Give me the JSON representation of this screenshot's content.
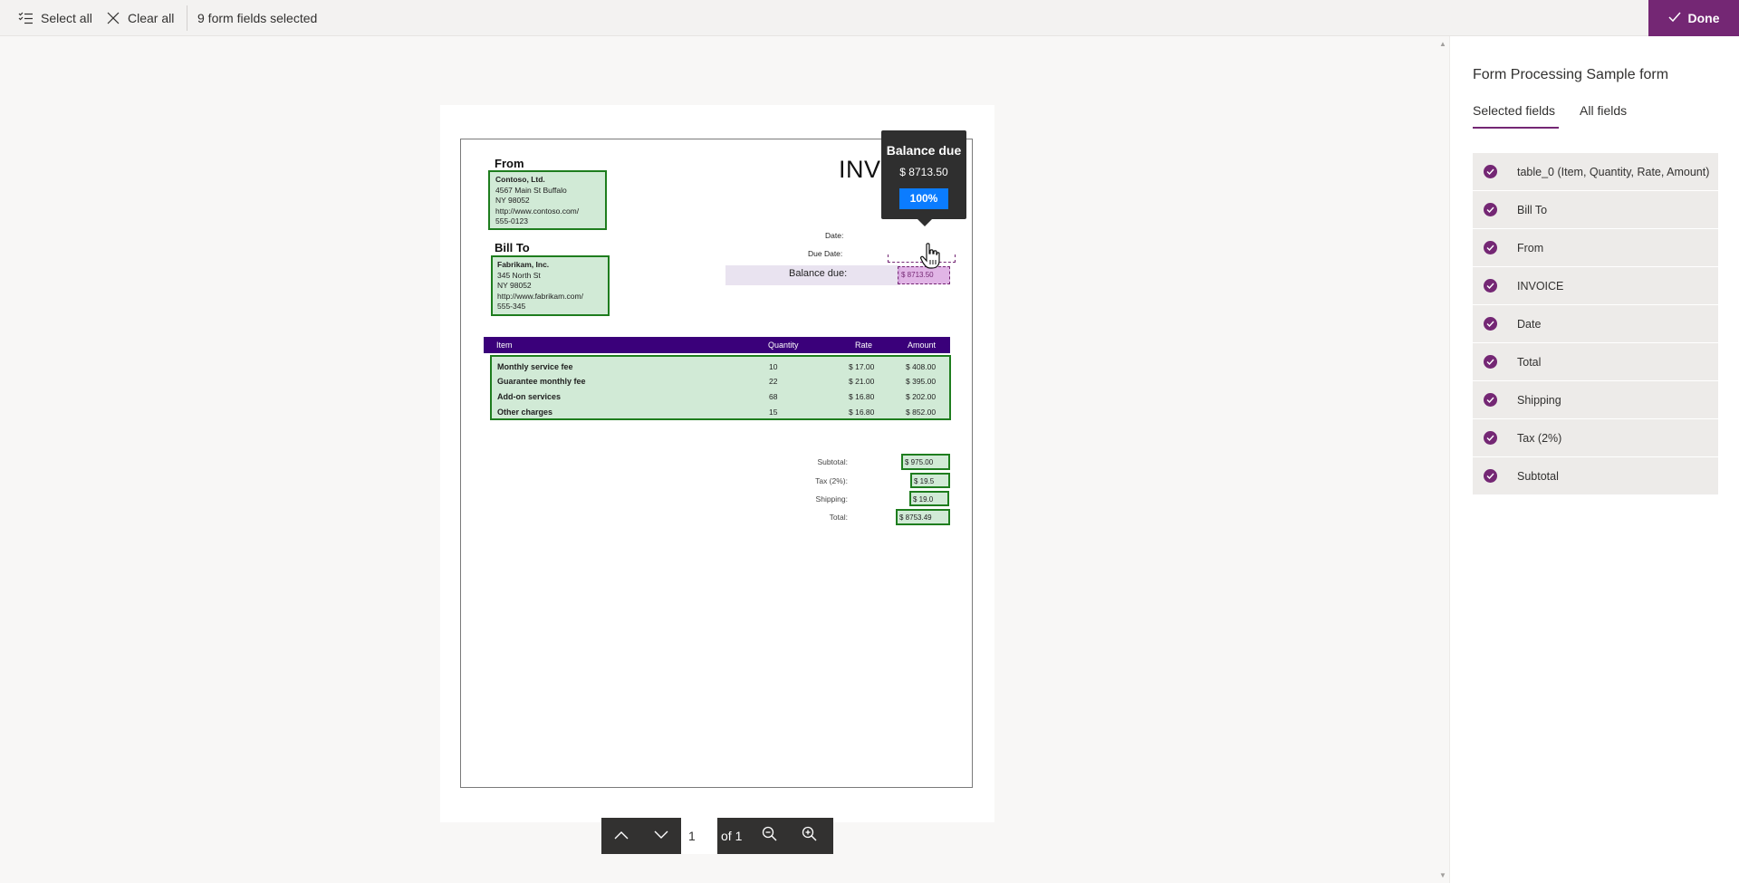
{
  "toolbar": {
    "select_all_label": "Select all",
    "clear_all_label": "Clear all",
    "selected_count_text": "9 form fields selected",
    "done_label": "Done",
    "accent_color": "#742774"
  },
  "document": {
    "from_heading": "From",
    "from_lines": [
      "Contoso, Ltd.",
      "4567 Main St Buffalo",
      "NY 98052",
      "http://www.contoso.com/",
      "555-0123"
    ],
    "bill_to_heading": "Bill To",
    "bill_to_lines": [
      "Fabrikam, Inc.",
      "345 North St",
      "NY 98052",
      "http://www.fabrikam.com/",
      "555-345"
    ],
    "invoice_title": "INVOICE",
    "date_label": "Date:",
    "due_date_label": "Due Date:",
    "balance_due_label": "Balance due:",
    "balance_due_value": "$ 8713.50",
    "table_headers": [
      "Item",
      "Quantity",
      "Rate",
      "Amount"
    ],
    "table_rows": [
      {
        "item": "Monthly service fee",
        "quantity": "10",
        "rate": "$ 17.00",
        "amount": "$ 408.00"
      },
      {
        "item": "Guarantee monthly fee",
        "quantity": "22",
        "rate": "$ 21.00",
        "amount": "$ 395.00"
      },
      {
        "item": "Add-on services",
        "quantity": "68",
        "rate": "$ 16.80",
        "amount": "$ 202.00"
      },
      {
        "item": "Other charges",
        "quantity": "15",
        "rate": "$ 16.80",
        "amount": "$ 852.00"
      }
    ],
    "subtotal_label": "Subtotal:",
    "subtotal_value": "$ 975.00",
    "tax_label": "Tax (2%):",
    "tax_value": "$ 19.5",
    "shipping_label": "Shipping:",
    "shipping_value": "$ 19.0",
    "total_label": "Total:",
    "total_value": "$ 8753.49"
  },
  "tooltip": {
    "title": "Balance due",
    "value": "$ 8713.50",
    "confidence": "100%"
  },
  "pager": {
    "current_page": "1",
    "of_text": "of 1"
  },
  "panel": {
    "title": "Form Processing Sample form",
    "tabs": [
      {
        "label": "Selected fields",
        "active": true
      },
      {
        "label": "All fields",
        "active": false
      }
    ],
    "fields": [
      "table_0 (Item, Quantity, Rate, Amount)",
      "Bill To",
      "From",
      "INVOICE",
      "Date",
      "Total",
      "Shipping",
      "Tax (2%)",
      "Subtotal"
    ]
  }
}
